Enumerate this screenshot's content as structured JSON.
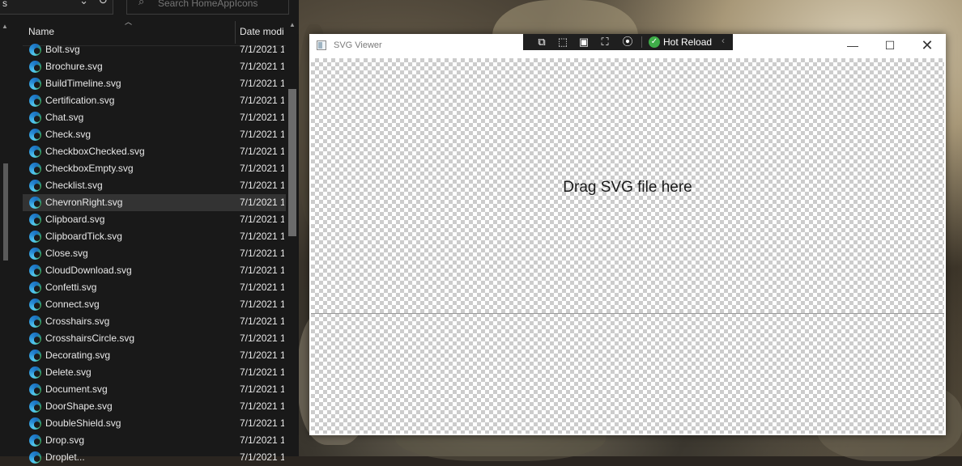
{
  "explorer": {
    "address_text": "s",
    "search_placeholder": "Search HomeAppIcons",
    "columns": {
      "name": "Name",
      "date": "Date modi"
    },
    "files": [
      {
        "name": "Bolt.svg",
        "date": "7/1/2021 1"
      },
      {
        "name": "Brochure.svg",
        "date": "7/1/2021 1"
      },
      {
        "name": "BuildTimeline.svg",
        "date": "7/1/2021 1"
      },
      {
        "name": "Certification.svg",
        "date": "7/1/2021 1"
      },
      {
        "name": "Chat.svg",
        "date": "7/1/2021 1"
      },
      {
        "name": "Check.svg",
        "date": "7/1/2021 1"
      },
      {
        "name": "CheckboxChecked.svg",
        "date": "7/1/2021 1"
      },
      {
        "name": "CheckboxEmpty.svg",
        "date": "7/1/2021 1"
      },
      {
        "name": "Checklist.svg",
        "date": "7/1/2021 1"
      },
      {
        "name": "ChevronRight.svg",
        "date": "7/1/2021 1"
      },
      {
        "name": "Clipboard.svg",
        "date": "7/1/2021 1"
      },
      {
        "name": "ClipboardTick.svg",
        "date": "7/1/2021 1"
      },
      {
        "name": "Close.svg",
        "date": "7/1/2021 1"
      },
      {
        "name": "CloudDownload.svg",
        "date": "7/1/2021 1"
      },
      {
        "name": "Confetti.svg",
        "date": "7/1/2021 1"
      },
      {
        "name": "Connect.svg",
        "date": "7/1/2021 1"
      },
      {
        "name": "Crosshairs.svg",
        "date": "7/1/2021 1"
      },
      {
        "name": "CrosshairsCircle.svg",
        "date": "7/1/2021 1"
      },
      {
        "name": "Decorating.svg",
        "date": "7/1/2021 1"
      },
      {
        "name": "Delete.svg",
        "date": "7/1/2021 1"
      },
      {
        "name": "Document.svg",
        "date": "7/1/2021 1"
      },
      {
        "name": "DoorShape.svg",
        "date": "7/1/2021 1"
      },
      {
        "name": "DoubleShield.svg",
        "date": "7/1/2021 1"
      },
      {
        "name": "Drop.svg",
        "date": "7/1/2021 1"
      },
      {
        "name": "Droplet...",
        "date": "7/1/2021 1"
      }
    ],
    "selected_index": 9,
    "file_icon": "edge-browser-icon"
  },
  "viewer": {
    "title": "SVG Viewer",
    "drop_hint": "Drag SVG file here",
    "toolbar": {
      "hot_reload_label": "Hot Reload",
      "icons": [
        "live-visual-tree-icon",
        "select-element-icon",
        "display-layout-adorners-icon",
        "track-focus-icon",
        "binding-failures-icon"
      ]
    },
    "window_controls": {
      "minimize": "—",
      "maximize": "☐",
      "close": "✕"
    }
  }
}
